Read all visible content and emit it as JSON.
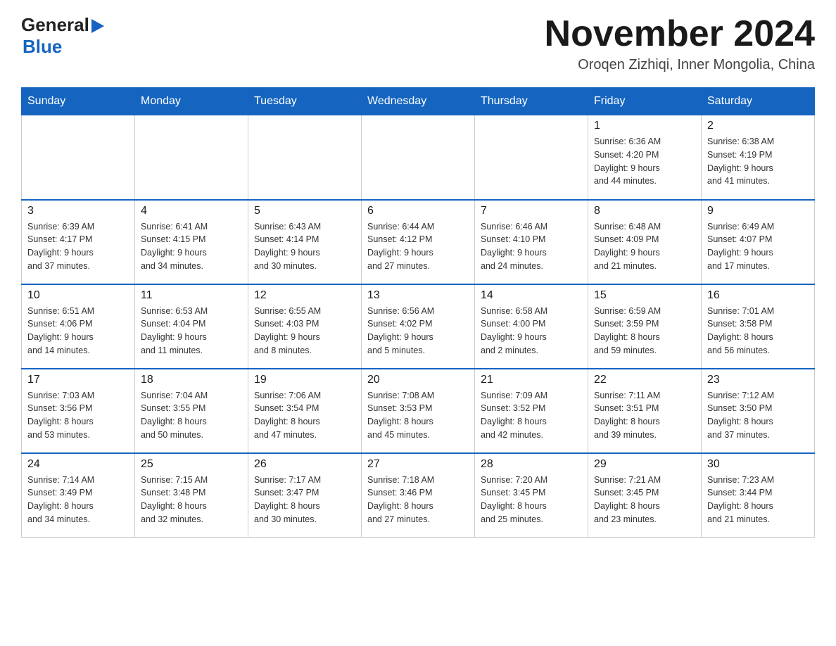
{
  "header": {
    "logo_general": "General",
    "logo_blue": "Blue",
    "month_title": "November 2024",
    "location": "Oroqen Zizhiqi, Inner Mongolia, China"
  },
  "days_of_week": [
    "Sunday",
    "Monday",
    "Tuesday",
    "Wednesday",
    "Thursday",
    "Friday",
    "Saturday"
  ],
  "weeks": [
    {
      "days": [
        {
          "number": "",
          "info": ""
        },
        {
          "number": "",
          "info": ""
        },
        {
          "number": "",
          "info": ""
        },
        {
          "number": "",
          "info": ""
        },
        {
          "number": "",
          "info": ""
        },
        {
          "number": "1",
          "info": "Sunrise: 6:36 AM\nSunset: 4:20 PM\nDaylight: 9 hours\nand 44 minutes."
        },
        {
          "number": "2",
          "info": "Sunrise: 6:38 AM\nSunset: 4:19 PM\nDaylight: 9 hours\nand 41 minutes."
        }
      ]
    },
    {
      "days": [
        {
          "number": "3",
          "info": "Sunrise: 6:39 AM\nSunset: 4:17 PM\nDaylight: 9 hours\nand 37 minutes."
        },
        {
          "number": "4",
          "info": "Sunrise: 6:41 AM\nSunset: 4:15 PM\nDaylight: 9 hours\nand 34 minutes."
        },
        {
          "number": "5",
          "info": "Sunrise: 6:43 AM\nSunset: 4:14 PM\nDaylight: 9 hours\nand 30 minutes."
        },
        {
          "number": "6",
          "info": "Sunrise: 6:44 AM\nSunset: 4:12 PM\nDaylight: 9 hours\nand 27 minutes."
        },
        {
          "number": "7",
          "info": "Sunrise: 6:46 AM\nSunset: 4:10 PM\nDaylight: 9 hours\nand 24 minutes."
        },
        {
          "number": "8",
          "info": "Sunrise: 6:48 AM\nSunset: 4:09 PM\nDaylight: 9 hours\nand 21 minutes."
        },
        {
          "number": "9",
          "info": "Sunrise: 6:49 AM\nSunset: 4:07 PM\nDaylight: 9 hours\nand 17 minutes."
        }
      ]
    },
    {
      "days": [
        {
          "number": "10",
          "info": "Sunrise: 6:51 AM\nSunset: 4:06 PM\nDaylight: 9 hours\nand 14 minutes."
        },
        {
          "number": "11",
          "info": "Sunrise: 6:53 AM\nSunset: 4:04 PM\nDaylight: 9 hours\nand 11 minutes."
        },
        {
          "number": "12",
          "info": "Sunrise: 6:55 AM\nSunset: 4:03 PM\nDaylight: 9 hours\nand 8 minutes."
        },
        {
          "number": "13",
          "info": "Sunrise: 6:56 AM\nSunset: 4:02 PM\nDaylight: 9 hours\nand 5 minutes."
        },
        {
          "number": "14",
          "info": "Sunrise: 6:58 AM\nSunset: 4:00 PM\nDaylight: 9 hours\nand 2 minutes."
        },
        {
          "number": "15",
          "info": "Sunrise: 6:59 AM\nSunset: 3:59 PM\nDaylight: 8 hours\nand 59 minutes."
        },
        {
          "number": "16",
          "info": "Sunrise: 7:01 AM\nSunset: 3:58 PM\nDaylight: 8 hours\nand 56 minutes."
        }
      ]
    },
    {
      "days": [
        {
          "number": "17",
          "info": "Sunrise: 7:03 AM\nSunset: 3:56 PM\nDaylight: 8 hours\nand 53 minutes."
        },
        {
          "number": "18",
          "info": "Sunrise: 7:04 AM\nSunset: 3:55 PM\nDaylight: 8 hours\nand 50 minutes."
        },
        {
          "number": "19",
          "info": "Sunrise: 7:06 AM\nSunset: 3:54 PM\nDaylight: 8 hours\nand 47 minutes."
        },
        {
          "number": "20",
          "info": "Sunrise: 7:08 AM\nSunset: 3:53 PM\nDaylight: 8 hours\nand 45 minutes."
        },
        {
          "number": "21",
          "info": "Sunrise: 7:09 AM\nSunset: 3:52 PM\nDaylight: 8 hours\nand 42 minutes."
        },
        {
          "number": "22",
          "info": "Sunrise: 7:11 AM\nSunset: 3:51 PM\nDaylight: 8 hours\nand 39 minutes."
        },
        {
          "number": "23",
          "info": "Sunrise: 7:12 AM\nSunset: 3:50 PM\nDaylight: 8 hours\nand 37 minutes."
        }
      ]
    },
    {
      "days": [
        {
          "number": "24",
          "info": "Sunrise: 7:14 AM\nSunset: 3:49 PM\nDaylight: 8 hours\nand 34 minutes."
        },
        {
          "number": "25",
          "info": "Sunrise: 7:15 AM\nSunset: 3:48 PM\nDaylight: 8 hours\nand 32 minutes."
        },
        {
          "number": "26",
          "info": "Sunrise: 7:17 AM\nSunset: 3:47 PM\nDaylight: 8 hours\nand 30 minutes."
        },
        {
          "number": "27",
          "info": "Sunrise: 7:18 AM\nSunset: 3:46 PM\nDaylight: 8 hours\nand 27 minutes."
        },
        {
          "number": "28",
          "info": "Sunrise: 7:20 AM\nSunset: 3:45 PM\nDaylight: 8 hours\nand 25 minutes."
        },
        {
          "number": "29",
          "info": "Sunrise: 7:21 AM\nSunset: 3:45 PM\nDaylight: 8 hours\nand 23 minutes."
        },
        {
          "number": "30",
          "info": "Sunrise: 7:23 AM\nSunset: 3:44 PM\nDaylight: 8 hours\nand 21 minutes."
        }
      ]
    }
  ]
}
